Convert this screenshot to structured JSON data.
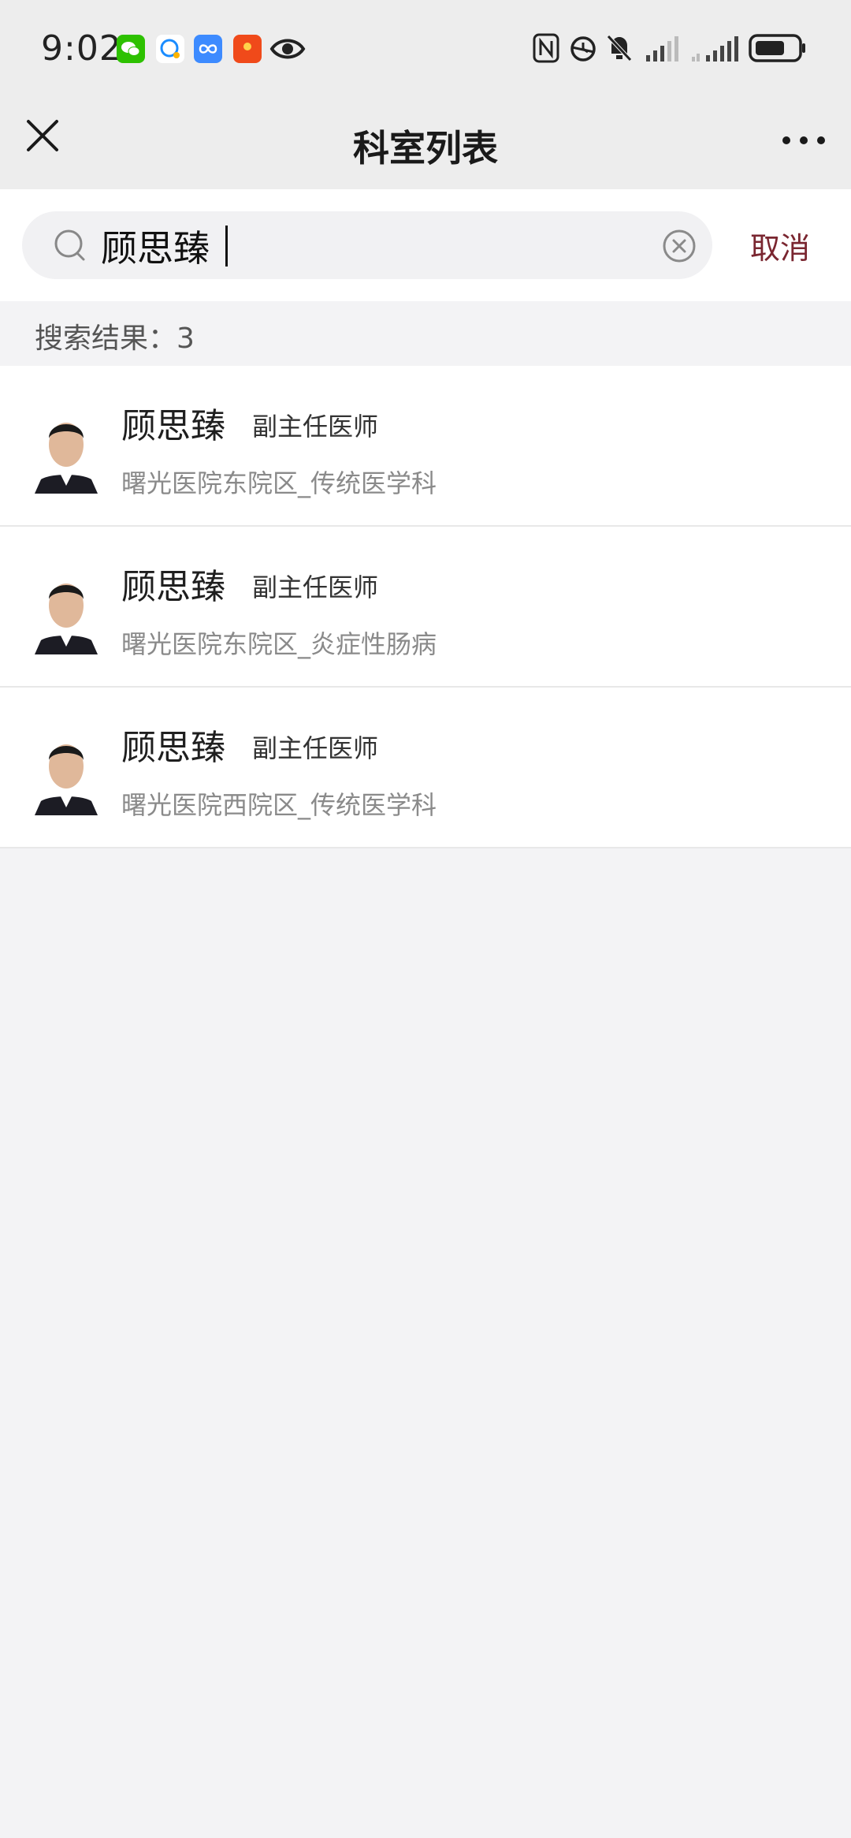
{
  "status_bar": {
    "time": "9:02",
    "app_icons": [
      "wechat-icon",
      "chat-bubble-icon",
      "infinity-app-icon",
      "red-envelope-icon",
      "eye-icon"
    ],
    "right_icons": [
      "nfc-icon",
      "alarm-icon",
      "bell-muted-icon",
      "signal-icon",
      "signal-secondary-icon",
      "battery-icon"
    ]
  },
  "nav": {
    "title": "科室列表",
    "close_icon": "close-icon",
    "more_icon": "more-icon"
  },
  "search": {
    "value": "顾思臻",
    "placeholder": "",
    "cancel_label": "取消"
  },
  "results": {
    "label": "搜索结果：3",
    "items": [
      {
        "name": "顾思臻",
        "title": "副主任医师",
        "dept": "曙光医院东院区_传统医学科"
      },
      {
        "name": "顾思臻",
        "title": "副主任医师",
        "dept": "曙光医院东院区_炎症性肠病"
      },
      {
        "name": "顾思臻",
        "title": "副主任医师",
        "dept": "曙光医院西院区_传统医学科"
      }
    ]
  },
  "colors": {
    "accent": "#7a2630",
    "background": "#f3f3f5",
    "nav_background": "#ededed"
  }
}
